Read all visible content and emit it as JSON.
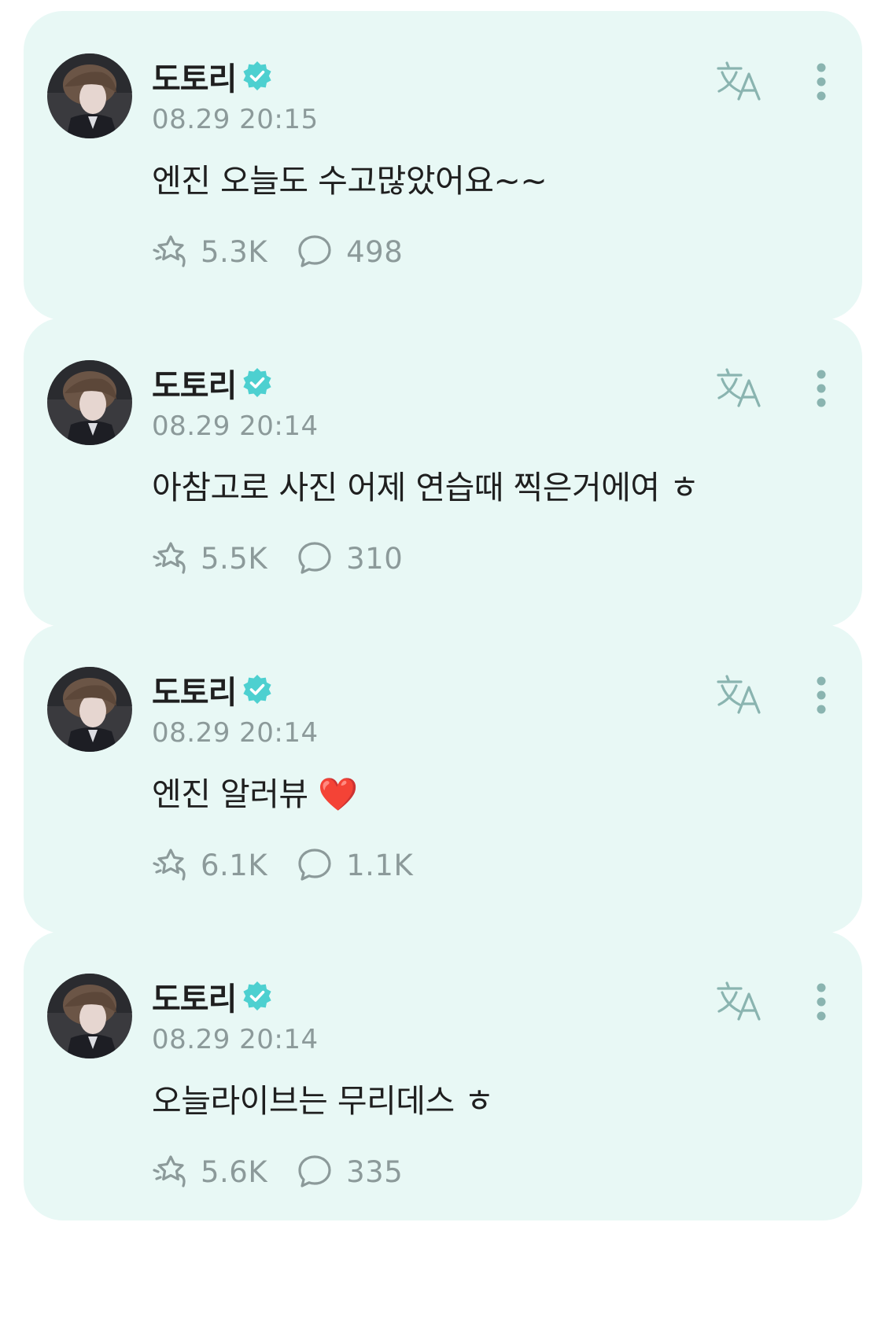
{
  "colors": {
    "card_bg": "#e8f8f5",
    "badge": "#4dd0d0",
    "muted_text": "#8c9a9a",
    "primary_text": "#1f1f1f"
  },
  "posts": [
    {
      "author": "도토리",
      "timestamp": "08.29 20:15",
      "text": "엔진 오늘도 수고많았어요~~",
      "reactions": "5.3K",
      "comments": "498",
      "icons": {
        "verified": "verified-badge-icon",
        "translate": "translate-icon",
        "more": "more-vertical-icon",
        "reaction": "reaction-icon",
        "comment": "comment-icon"
      }
    },
    {
      "author": "도토리",
      "timestamp": "08.29 20:14",
      "text": "아참고로 사진 어제 연습때 찍은거에여 ㅎ",
      "reactions": "5.5K",
      "comments": "310",
      "icons": {
        "verified": "verified-badge-icon",
        "translate": "translate-icon",
        "more": "more-vertical-icon",
        "reaction": "reaction-icon",
        "comment": "comment-icon"
      }
    },
    {
      "author": "도토리",
      "timestamp": "08.29 20:14",
      "text": "엔진 알러뷰 ❤️",
      "reactions": "6.1K",
      "comments": "1.1K",
      "icons": {
        "verified": "verified-badge-icon",
        "translate": "translate-icon",
        "more": "more-vertical-icon",
        "reaction": "reaction-icon",
        "comment": "comment-icon"
      }
    },
    {
      "author": "도토리",
      "timestamp": "08.29 20:14",
      "text": "오늘라이브는 무리데스 ㅎ",
      "reactions": "5.6K",
      "comments": "335",
      "icons": {
        "verified": "verified-badge-icon",
        "translate": "translate-icon",
        "more": "more-vertical-icon",
        "reaction": "reaction-icon",
        "comment": "comment-icon"
      }
    }
  ]
}
